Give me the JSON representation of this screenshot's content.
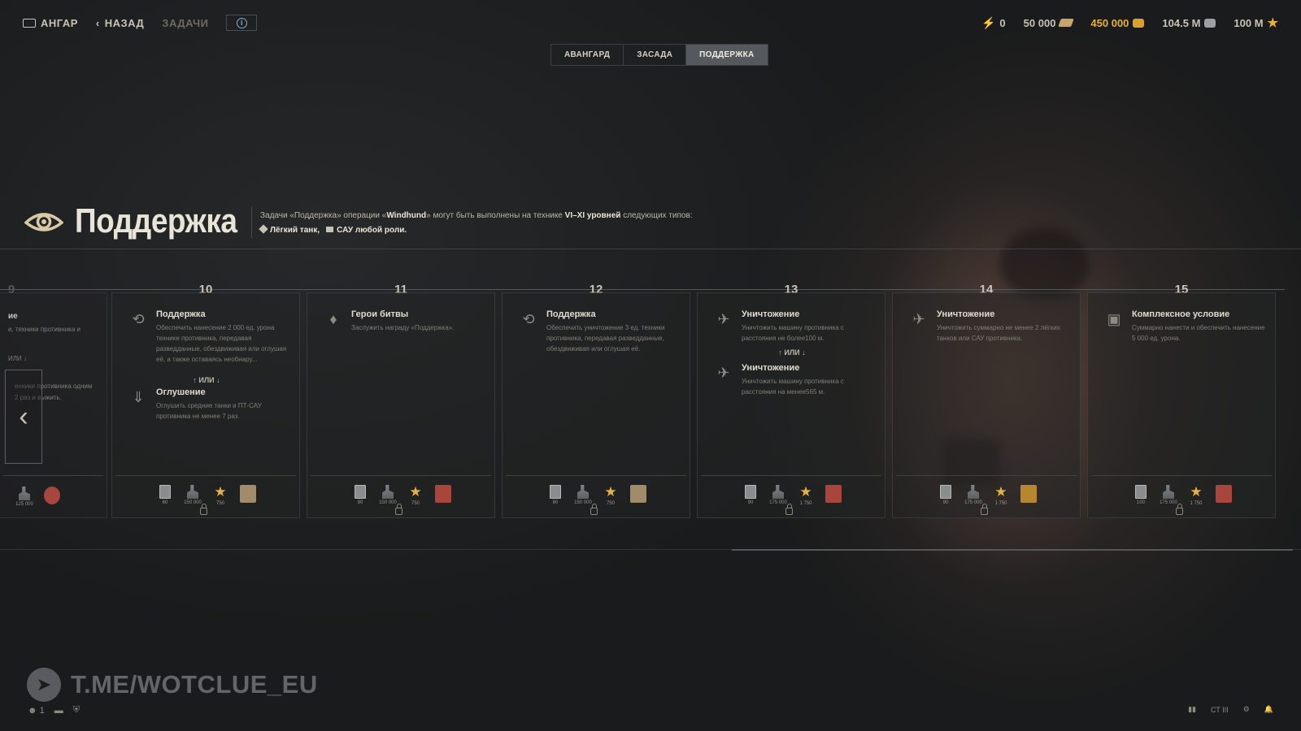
{
  "topbar": {
    "hangar_label": "АНГАР",
    "back_label": "НАЗАД",
    "tasks_label": "ЗАДАЧИ",
    "currencies": {
      "free": "0",
      "bonds": "50 000",
      "gold": "450 000",
      "silver": "104.5 M",
      "free_xp": "100 M"
    }
  },
  "tabs": [
    "АВАНГАРД",
    "ЗАСАДА",
    "ПОДДЕРЖКА"
  ],
  "active_tab": "ПОДДЕРЖКА",
  "header": {
    "title": "Поддержка",
    "desc_prefix": "Задачи «Поддержка» операции «",
    "op_name": "Windhund",
    "desc_mid": "» могут быть выполнены на технике ",
    "tiers": "VI–XI уровней",
    "desc_suffix": " следующих типов:",
    "type1": "Лёгкий танк,",
    "type2": "САУ любой роли."
  },
  "partial_card": {
    "line1": "ие",
    "line2": "и, техники противника и",
    "or": "ИЛИ ↓",
    "line3": "ехники противника одним",
    "line4": "2 раз и выжить.",
    "reward_label": "125 000"
  },
  "cards": [
    {
      "number": "10",
      "task1_name": "Поддержка",
      "task1_desc": "Обеспечить нанесение 2 000 ед. урона технике противника, передавая разведданные, обездвиживая или оглушая её, а также оставаясь необнару...",
      "or_label": "↑ ИЛИ ↓",
      "task2_name": "Оглушение",
      "task2_desc": "Оглушить средние танки и ПТ-САУ противника не менее 7 раз.",
      "rewards": [
        "60",
        "150 000",
        "750",
        ""
      ]
    },
    {
      "number": "11",
      "task1_name": "Герои битвы",
      "task1_desc": "Заслужить награду «Поддержка».",
      "rewards": [
        "80",
        "150 000",
        "750",
        ""
      ]
    },
    {
      "number": "12",
      "task1_name": "Поддержка",
      "task1_desc": "Обеспечить уничтожение 3 ед. техники противника, передавая разведданные, обездвиживая или оглушая её.",
      "rewards": [
        "80",
        "150 000",
        "750",
        ""
      ]
    },
    {
      "number": "13",
      "task1_name": "Уничтожение",
      "task1_desc": "Уничтожить машину противника с расстояния не более100 м.",
      "or_label": "↑ ИЛИ ↓",
      "task2_name": "Уничтожение",
      "task2_desc": "Уничтожить машину противника с расстояния на менее565 м.",
      "rewards": [
        "90",
        "175 000",
        "1 750",
        ""
      ]
    },
    {
      "number": "14",
      "task1_name": "Уничтожение",
      "task1_desc": "Уничтожить суммарно не менее 2 лёгких танков или САУ противника.",
      "rewards": [
        "90",
        "175 000",
        "1 750",
        ""
      ]
    },
    {
      "number": "15",
      "task1_name": "Комплексное условие",
      "task1_desc": "Суммарно нанести и обеспечить нанесение 5 000 ед. урона.",
      "rewards": [
        "100",
        "175 000",
        "1 750",
        ""
      ]
    }
  ],
  "prev_number": "9",
  "watermark": "T.ME/WOTCLUE_EU",
  "bottom": {
    "players": "1",
    "tier_label": "СТ III"
  }
}
